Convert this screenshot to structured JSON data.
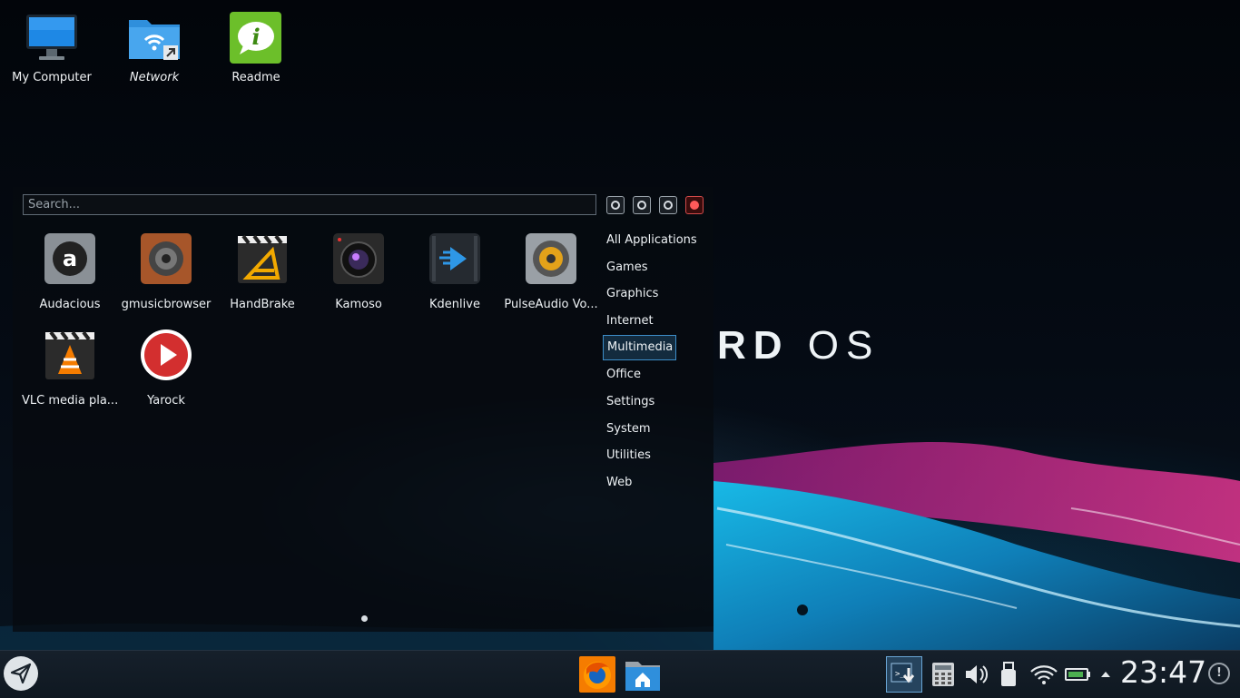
{
  "wallpaper": {
    "brand_light": "RD",
    "brand_text": "OS"
  },
  "desktop": {
    "icons": [
      {
        "label": "My Computer"
      },
      {
        "label": "Network"
      },
      {
        "label": "Readme"
      }
    ]
  },
  "launcher": {
    "search": {
      "placeholder": "Search..."
    },
    "power_buttons": [
      "lock",
      "logout",
      "restart",
      "shutdown"
    ],
    "apps": [
      {
        "label": "Audacious",
        "icon": "audacious-icon"
      },
      {
        "label": "gmusicbrowser",
        "icon": "speaker-icon"
      },
      {
        "label": "HandBrake",
        "icon": "handbrake-icon"
      },
      {
        "label": "Kamoso",
        "icon": "camera-icon"
      },
      {
        "label": "Kdenlive",
        "icon": "kdenlive-icon"
      },
      {
        "label": "PulseAudio Vo...",
        "icon": "volume-knob-icon"
      },
      {
        "label": "VLC media pla...",
        "icon": "vlc-icon"
      },
      {
        "label": "Yarock",
        "icon": "play-icon"
      }
    ],
    "categories": [
      {
        "label": "All Applications"
      },
      {
        "label": "Games"
      },
      {
        "label": "Graphics"
      },
      {
        "label": "Internet"
      },
      {
        "label": "Multimedia",
        "active": true
      },
      {
        "label": "Office"
      },
      {
        "label": "Settings"
      },
      {
        "label": "System"
      },
      {
        "label": "Utilities"
      },
      {
        "label": "Web"
      }
    ]
  },
  "taskbar": {
    "pinned": [
      "firefox-icon",
      "home-folder-icon"
    ],
    "tray": [
      "update-icon",
      "calculator-icon",
      "volume-icon",
      "usb-icon",
      "wifi-icon",
      "battery-icon",
      "expand-arrow-icon"
    ],
    "clock": "23:47",
    "notification_symbol": "!"
  },
  "colors": {
    "accent": "#3d8ec9",
    "shutdown": "#ff5a5a"
  }
}
